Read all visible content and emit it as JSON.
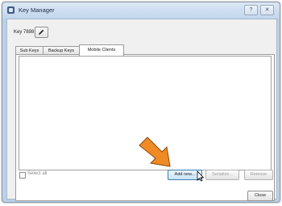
{
  "window": {
    "title": "Key Manager",
    "help_glyph": "?",
    "close_glyph": "✕"
  },
  "key": {
    "label": "Key 7898"
  },
  "tabs": [
    {
      "label": "Sub Keys",
      "active": false
    },
    {
      "label": "Backup Keys",
      "active": false
    },
    {
      "label": "Mobile Clients",
      "active": true
    }
  ],
  "mobile_clients": {
    "items": []
  },
  "footer": {
    "select_all_label": "Select all",
    "add_new_label": "Add new...",
    "serialize_label": "Serialize...",
    "remove_label": "Remove",
    "close_label": "Close"
  },
  "colors": {
    "annotation_arrow": "#f08a24",
    "window_frame": "#b9d1ea",
    "dialog_background": "#f0f0f0"
  }
}
